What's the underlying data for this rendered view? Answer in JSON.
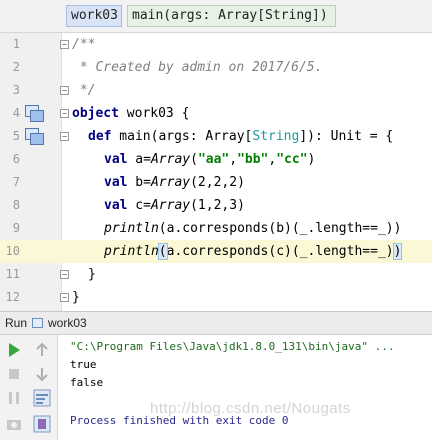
{
  "breadcrumbs": [
    "work03",
    "main(args: Array[String])"
  ],
  "editor": {
    "lines": [
      {
        "n": "1"
      },
      {
        "n": "2"
      },
      {
        "n": "3"
      },
      {
        "n": "4"
      },
      {
        "n": "5"
      },
      {
        "n": "6"
      },
      {
        "n": "7"
      },
      {
        "n": "8"
      },
      {
        "n": "9"
      },
      {
        "n": "10"
      },
      {
        "n": "11"
      },
      {
        "n": "12"
      }
    ],
    "code": {
      "l1": "/**",
      "l2": " * Created by admin on 2017/6/5.",
      "l3": " */",
      "l4_kw": "object",
      "l4_rest": " work03 {",
      "l5_kw": "def",
      "l5_a": " main(args: Array[",
      "l5_type": "String",
      "l5_b": "]): Unit = {",
      "l6_kw": "val",
      "l6_a": " a=",
      "l6_arr": "Array",
      "l6_p1": "(",
      "l6_s1": "\"aa\"",
      "l6_c1": ",",
      "l6_s2": "\"bb\"",
      "l6_c2": ",",
      "l6_s3": "\"cc\"",
      "l6_p2": ")",
      "l7_kw": "val",
      "l7_a": " b=",
      "l7_arr": "Array",
      "l7_b": "(2,2,2)",
      "l8_kw": "val",
      "l8_a": " c=",
      "l8_arr": "Array",
      "l8_b": "(1,2,3)",
      "l9_fn": "println",
      "l9_b": "(a.corresponds(b)(_.length==_))",
      "l10_fn": "println",
      "l10_p": "(",
      "l10_b": "a.corresponds(c)(_.length==_)",
      "l10_e": ")",
      "l11": "}",
      "l12": "}"
    }
  },
  "run": {
    "label": "Run",
    "config_name": "work03"
  },
  "console": {
    "command": "\"C:\\Program Files\\Java\\jdk1.8.0_131\\bin\\java\" ...",
    "out1": "true",
    "out2": "false",
    "finish": "Process finished with exit code 0"
  },
  "watermark": "http://blog.csdn.net/Nougats",
  "icons": [
    "override-icon",
    "fold-icon",
    "run-icon",
    "stop-icon",
    "up-arrow-icon",
    "down-arrow-icon",
    "pause-icon",
    "wrap-icon",
    "camera-icon",
    "print-icon"
  ]
}
